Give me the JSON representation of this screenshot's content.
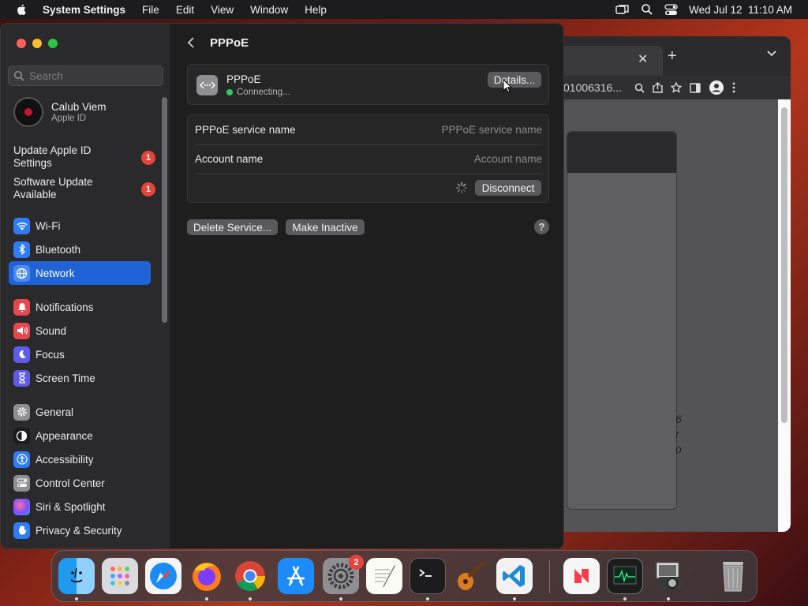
{
  "menubar": {
    "app_name": "System Settings",
    "menus": [
      "File",
      "Edit",
      "View",
      "Window",
      "Help"
    ],
    "datetime": "Wed Jul 12  11:10 AM"
  },
  "browser": {
    "tab_close": "✕",
    "new_tab": "+",
    "address": "01006316...",
    "side_text": "6 r o"
  },
  "sidebar": {
    "search_placeholder": "Search",
    "account": {
      "name": "Calub Viem",
      "subtitle": "Apple ID"
    },
    "notices": [
      {
        "label": "Update Apple ID Settings",
        "badge": "1"
      },
      {
        "label": "Software Update Available",
        "badge": "1"
      }
    ],
    "items": [
      {
        "label": "Wi-Fi",
        "icon": "wifi-icon",
        "color": "#2f7cf6"
      },
      {
        "label": "Bluetooth",
        "icon": "bluetooth-icon",
        "color": "#2f7cf6"
      },
      {
        "label": "Network",
        "icon": "globe-icon",
        "color": "#2f7cf6",
        "selected": true
      },
      {
        "label": "Notifications",
        "icon": "bell-icon",
        "color": "#e5484d"
      },
      {
        "label": "Sound",
        "icon": "speaker-icon",
        "color": "#e5484d"
      },
      {
        "label": "Focus",
        "icon": "moon-icon",
        "color": "#5e5ce6"
      },
      {
        "label": "Screen Time",
        "icon": "hourglass-icon",
        "color": "#5e5ce6"
      },
      {
        "label": "General",
        "icon": "gear-icon",
        "color": "#8e8e93"
      },
      {
        "label": "Appearance",
        "icon": "appearance-icon",
        "color": "#1c1c1e"
      },
      {
        "label": "Accessibility",
        "icon": "accessibility-icon",
        "color": "#2f7cf6"
      },
      {
        "label": "Control Center",
        "icon": "control-center-icon",
        "color": "#8e8e93"
      },
      {
        "label": "Siri & Spotlight",
        "icon": "siri-icon",
        "color": "#b84fd6"
      },
      {
        "label": "Privacy & Security",
        "icon": "hand-icon",
        "color": "#2f7cf6"
      }
    ]
  },
  "main": {
    "title": "PPPoE",
    "service": {
      "name": "PPPoE",
      "status": "Connecting...",
      "details_label": "Details..."
    },
    "form": {
      "service_name_label": "PPPoE service name",
      "service_name_placeholder": "PPPoE service name",
      "account_label": "Account name",
      "account_placeholder": "Account name",
      "disconnect_label": "Disconnect"
    },
    "delete_label": "Delete Service...",
    "inactive_label": "Make Inactive",
    "help_label": "?"
  },
  "dock": {
    "apps": [
      "Finder",
      "Launchpad",
      "Safari",
      "Firefox",
      "Chrome",
      "App Store",
      "System Settings",
      "TextEdit",
      "Terminal",
      "GarageBand",
      "VS Code",
      "News",
      "Activity Monitor",
      "Image Capture",
      "Trash"
    ],
    "settings_badge": "2"
  }
}
